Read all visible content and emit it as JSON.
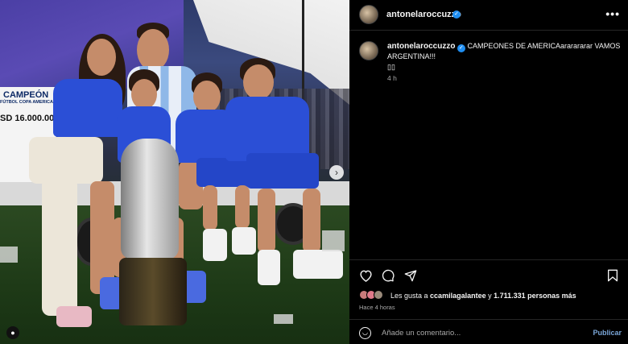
{
  "board": {
    "title": "CAMPEÓN",
    "subtitle": "FÚTBOL COPA AMERICA 20",
    "amount": "SD 16.000.000"
  },
  "header": {
    "username": "antonelaroccuzzo",
    "more_label": "•••"
  },
  "caption": {
    "username": "antonelaroccuzzo",
    "text": "CAMPEONES DE AMERICAararararar VAMOS ARGENTINA!!!",
    "emoji": "▯▯",
    "time": "4 h"
  },
  "likes": {
    "prefix": "Les gusta a ",
    "user": "ccamilagalantee",
    "middle": " y ",
    "count": "1.711.331 personas más",
    "time": "Hace 4 horas"
  },
  "comment": {
    "placeholder": "Añade un comentario...",
    "publish_label": "Publicar"
  },
  "icons": {
    "like": "heart-icon",
    "comment": "comment-icon",
    "share": "send-icon",
    "save": "bookmark-icon",
    "emoji": "smiley-icon",
    "verified": "verified-badge-icon",
    "next": "chevron-right-icon",
    "tag": "person-tag-icon"
  },
  "colors": {
    "background": "#000000",
    "text": "#f5f5f5",
    "muted": "#a8a8a8",
    "link": "#7aa6d8",
    "verified": "#1f8ef1"
  }
}
